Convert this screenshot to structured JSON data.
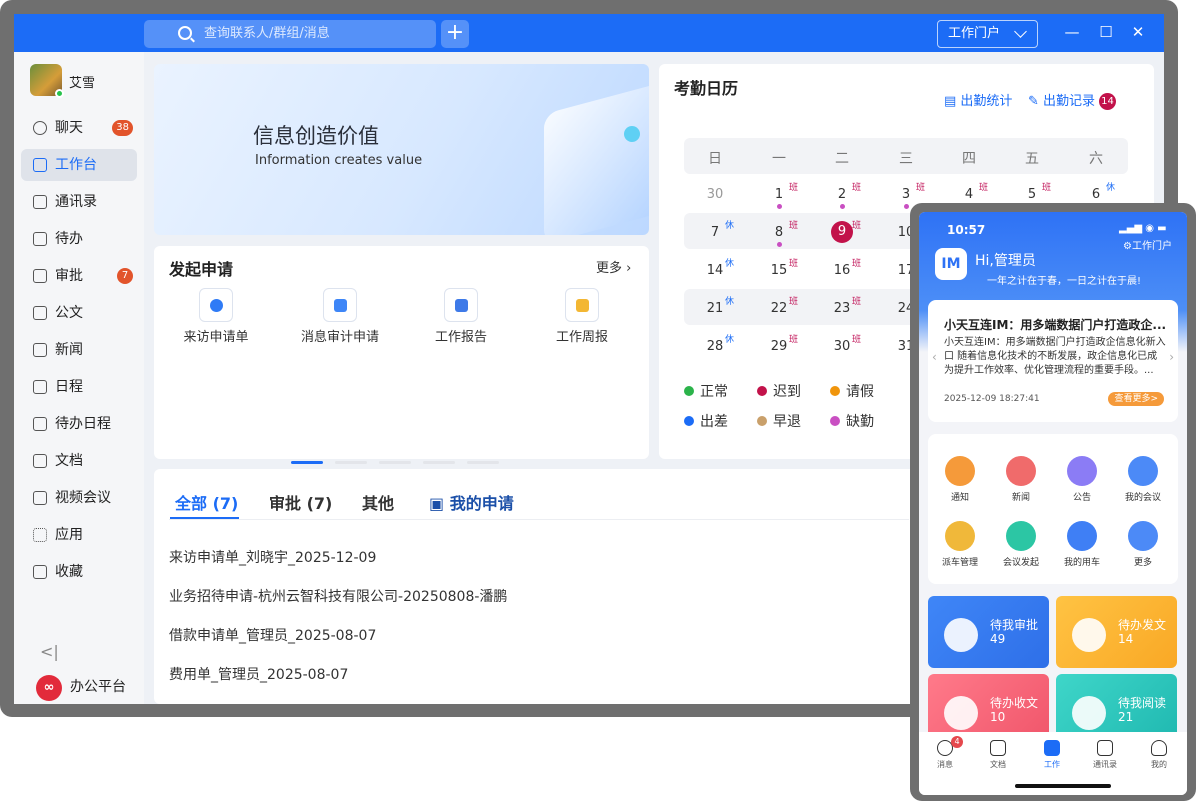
{
  "desktop": {
    "search_placeholder": "查询联系人/群组/消息",
    "plus": "+",
    "portal": "工作门户",
    "win_min": "—",
    "win_max": "☐",
    "win_close": "✕",
    "user": "艾雪",
    "nav": [
      {
        "label": "聊天",
        "badge": "38"
      },
      {
        "label": "工作台"
      },
      {
        "label": "通讯录"
      },
      {
        "label": "待办"
      },
      {
        "label": "审批",
        "badge": "7"
      },
      {
        "label": "公文"
      },
      {
        "label": "新闻"
      },
      {
        "label": "日程"
      },
      {
        "label": "待办日程"
      },
      {
        "label": "文档"
      },
      {
        "label": "视频会议"
      },
      {
        "label": "应用"
      },
      {
        "label": "收藏"
      }
    ],
    "collapse": "<|",
    "office": "办公平台",
    "banner": {
      "title": "信息创造价值",
      "subtitle": "Information creates value"
    },
    "apply": {
      "title": "发起申请",
      "more": "更多",
      "apps": [
        "来访申请单",
        "消息审计申请",
        "工作报告",
        "工作周报"
      ]
    },
    "calendar": {
      "title": "考勤日历",
      "stats": "出勤统计",
      "records": "出勤记录",
      "records_badge": "14",
      "weekdays": [
        "日",
        "一",
        "二",
        "三",
        "四",
        "五",
        "六"
      ],
      "rows": [
        [
          "30",
          "1",
          "2",
          "3",
          "4",
          "5",
          "6"
        ],
        [
          "7",
          "8",
          "9",
          "10",
          "",
          "",
          ""
        ],
        [
          "14",
          "15",
          "16",
          "17",
          "",
          "",
          ""
        ],
        [
          "21",
          "22",
          "23",
          "24",
          "",
          "",
          ""
        ],
        [
          "28",
          "29",
          "30",
          "31",
          "",
          "",
          ""
        ]
      ],
      "ban": "班",
      "xiu": "休",
      "legend": [
        {
          "label": "正常",
          "color": "#2bb34a"
        },
        {
          "label": "迟到",
          "color": "#c2124a"
        },
        {
          "label": "请假",
          "color": "#f0950c"
        },
        {
          "label": "出差",
          "color": "#1c6cf6"
        },
        {
          "label": "早退",
          "color": "#c9a06b"
        },
        {
          "label": "缺勤",
          "color": "#c94fc2"
        }
      ]
    },
    "tabs": [
      "全部 (7)",
      "审批 (7)",
      "其他",
      "我的申请"
    ],
    "list": [
      "来访申请单_刘晓宇_2025-12-09",
      "业务招待申请-杭州云智科技有限公司-20250808-潘鹏",
      "借款申请单_管理员_2025-08-07",
      "费用单_管理员_2025-08-07"
    ]
  },
  "phone": {
    "time": "10:57",
    "portal": "工作门户",
    "hello": "Hi,管理员",
    "motto": "一年之计在于春，一日之计在于晨!",
    "news_title": "小天互连IM：用多端数据门户打造政企...",
    "news_body": "小天互连IM：用多端数据门户打造政企信息化新入口 随着信息化技术的不断发展，政企信息化已成为提升工作效率、优化管理流程的重要手段。...",
    "news_time": "2025-12-09 18:27:41",
    "news_more": "查看更多>",
    "grid": [
      "通知",
      "新闻",
      "公告",
      "我的会议",
      "派车管理",
      "会议发起",
      "我的用车",
      "更多"
    ],
    "tiles": [
      {
        "label": "待我审批",
        "count": "49"
      },
      {
        "label": "待办发文",
        "count": "14"
      },
      {
        "label": "待办收文",
        "count": "10"
      },
      {
        "label": "待我阅读",
        "count": "21"
      }
    ],
    "bar": [
      {
        "label": "消息",
        "badge": "4"
      },
      {
        "label": "文档"
      },
      {
        "label": "工作"
      },
      {
        "label": "通讯录"
      },
      {
        "label": "我的"
      }
    ]
  }
}
